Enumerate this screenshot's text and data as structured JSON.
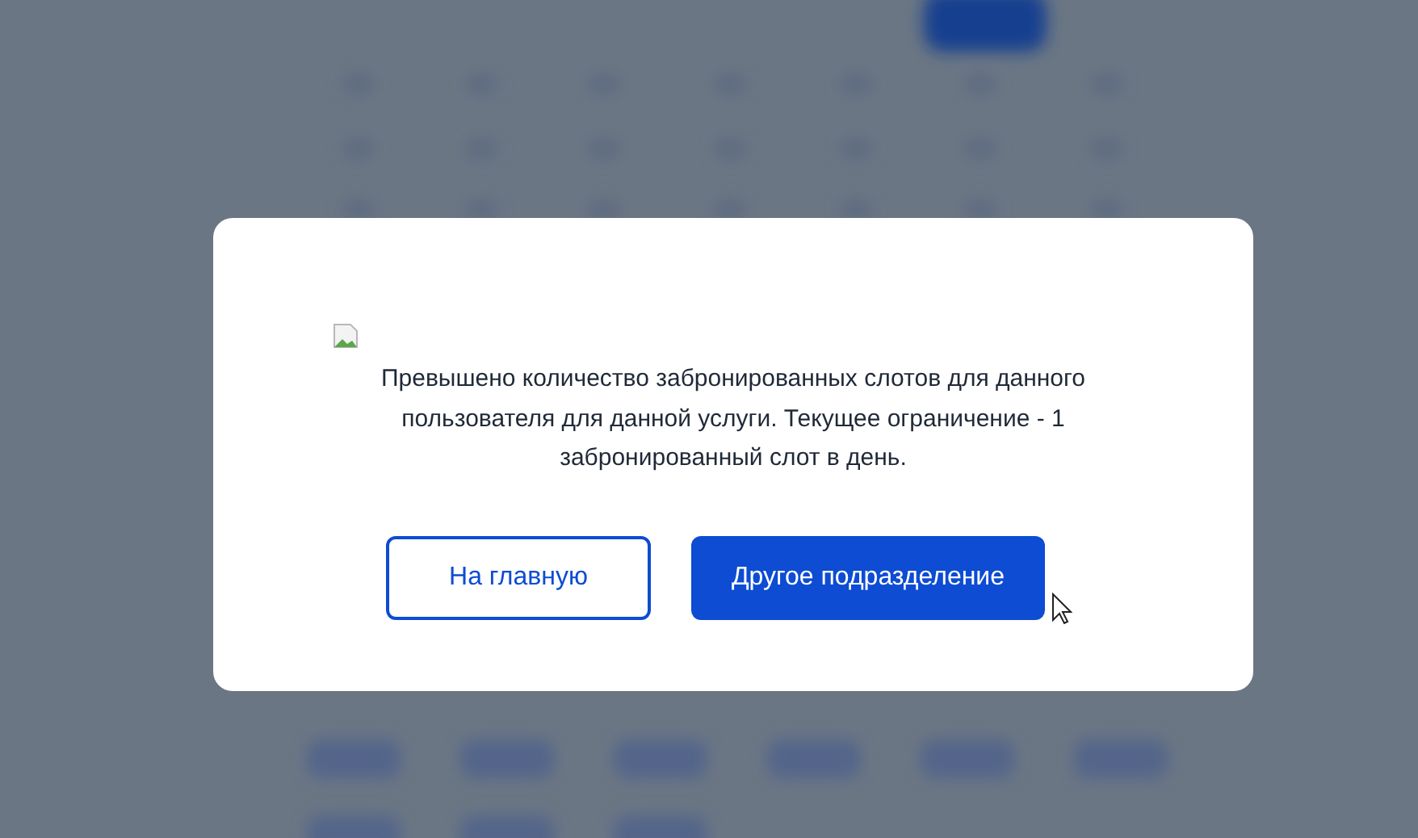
{
  "dialog": {
    "message": "Превышено количество забронированных слотов для данного пользователя для данной услуги. Текущее ограничение - 1 забронированный слот в день.",
    "buttons": [
      {
        "label": "На главную",
        "kind": "secondary"
      },
      {
        "label": "Другое подразделение",
        "kind": "primary"
      }
    ]
  }
}
